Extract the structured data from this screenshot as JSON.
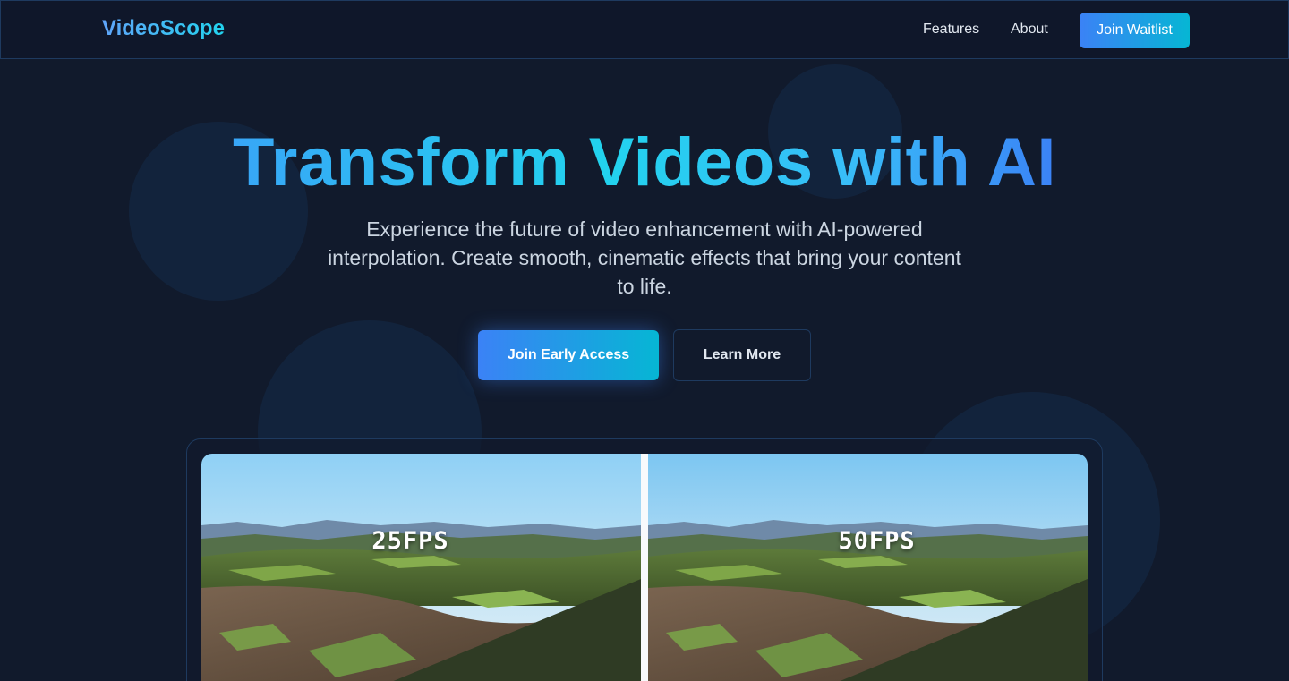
{
  "nav": {
    "logo": "VideoScope",
    "links": [
      "Features",
      "About"
    ],
    "cta": "Join Waitlist"
  },
  "hero": {
    "title": "Transform Videos with AI",
    "subtitle": "Experience the future of video enhancement with AI-powered interpolation. Create smooth, cinematic effects that bring your content to life.",
    "primary_button": "Join Early Access",
    "secondary_button": "Learn More"
  },
  "comparison": {
    "left_label": "25FPS",
    "right_label": "50FPS"
  },
  "colors": {
    "background": "#111a2c",
    "accent_blue": "#3b82f6",
    "accent_cyan": "#06b6d4",
    "border": "#1e3a5f"
  }
}
